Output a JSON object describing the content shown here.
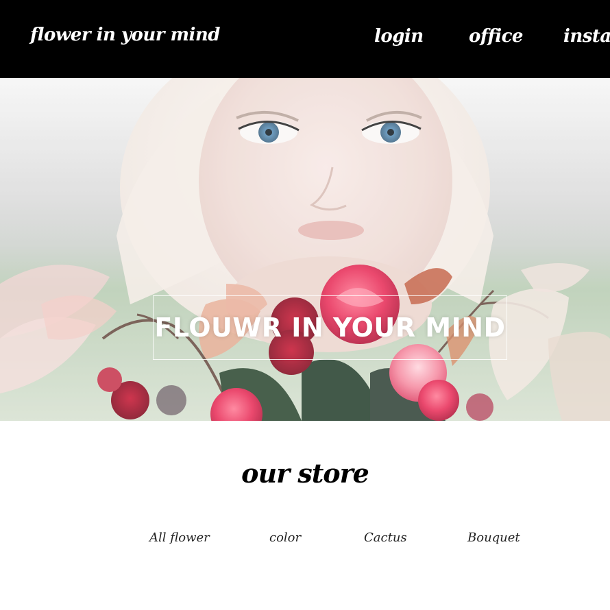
{
  "header": {
    "brand": "flower in your mind",
    "nav": [
      "login",
      "office",
      "instagram"
    ]
  },
  "hero": {
    "title": "FLOUWR IN YOUR MIND",
    "image_subject": "woman holding a bouquet of red and pink flowers"
  },
  "store": {
    "heading": "our store",
    "categories": [
      "All flower",
      "color",
      "Cactus",
      "Bouquet"
    ]
  },
  "colors": {
    "header_bg": "#000000",
    "header_text": "#ffffff",
    "page_bg": "#ffffff",
    "heading_text": "#000000"
  }
}
